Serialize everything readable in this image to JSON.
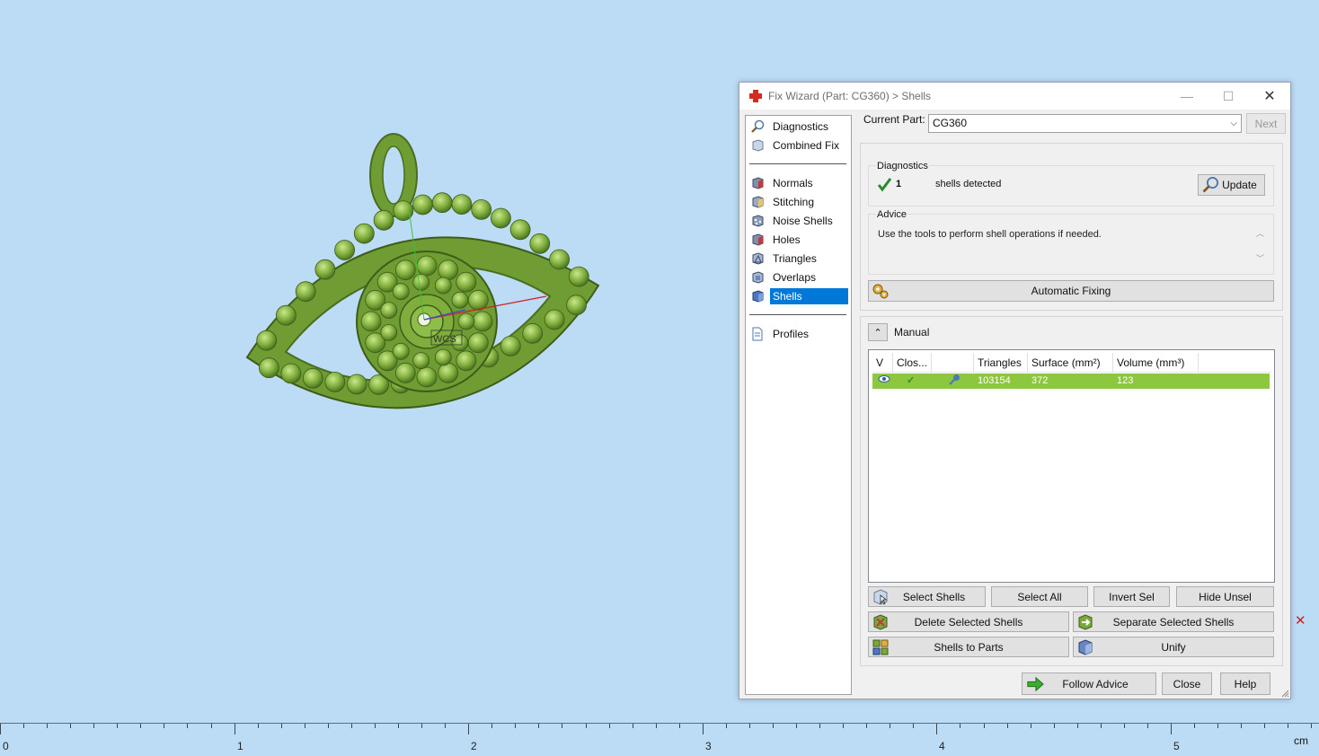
{
  "dialog": {
    "title": "Fix Wizard (Part: CG360) > Shells",
    "nav": {
      "items": [
        {
          "label": "Diagnostics"
        },
        {
          "label": "Combined Fix"
        },
        {
          "label": "Normals"
        },
        {
          "label": "Stitching"
        },
        {
          "label": "Noise Shells"
        },
        {
          "label": "Holes"
        },
        {
          "label": "Triangles"
        },
        {
          "label": "Overlaps"
        },
        {
          "label": "Shells",
          "selected": true
        },
        {
          "label": "Profiles"
        }
      ]
    },
    "current_part": {
      "label": "Current Part:",
      "value": "CG360",
      "next_label": "Next"
    },
    "diagnostics": {
      "heading": "Diagnostics",
      "count": "1",
      "text": "shells detected",
      "update_label": "Update"
    },
    "advice": {
      "heading": "Advice",
      "text": "Use the tools to perform shell operations if needed."
    },
    "automatic_fixing_label": "Automatic Fixing",
    "manual": {
      "heading": "Manual",
      "columns": [
        "V",
        "Clos...",
        "",
        "Triangles",
        "Surface (mm²)",
        "Volume (mm³)"
      ],
      "rows": [
        {
          "triangles": "103154",
          "surface": "372",
          "volume": "123"
        }
      ]
    },
    "buttons": {
      "select_shells": "Select Shells",
      "select_all": "Select All",
      "invert_sel": "Invert Sel",
      "hide_unsel": "Hide Unsel",
      "delete_selected": "Delete Selected Shells",
      "separate_selected": "Separate Selected Shells",
      "shells_to_parts": "Shells to Parts",
      "unify": "Unify",
      "follow_advice": "Follow Advice",
      "close": "Close",
      "help": "Help"
    }
  },
  "viewport": {
    "wcs_label": "WCS",
    "model_color": "#7aa83a"
  },
  "ruler": {
    "labels": [
      "0",
      "1",
      "2",
      "3",
      "4",
      "5"
    ],
    "unit": "cm"
  }
}
